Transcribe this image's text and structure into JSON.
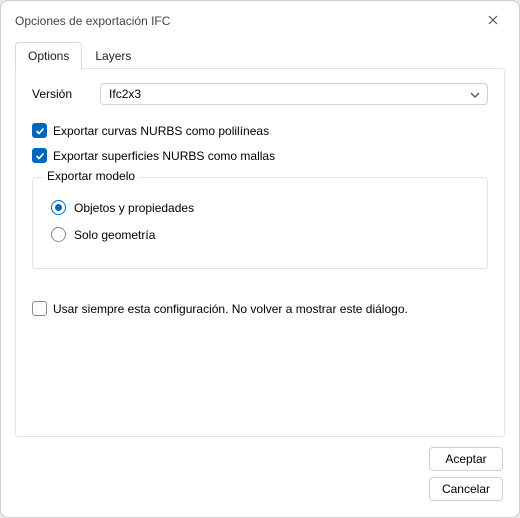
{
  "window": {
    "title": "Opciones de exportación IFC"
  },
  "tabs": {
    "options": "Options",
    "layers": "Layers"
  },
  "version": {
    "label": "Versión",
    "selected": "Ifc2x3"
  },
  "checks": {
    "curves": "Exportar curvas NURBS como polilíneas",
    "surfaces": "Exportar superficies NURBS como mallas"
  },
  "model_group": {
    "legend": "Exportar modelo",
    "objects": "Objetos y propiedades",
    "geometry": "Solo geometría"
  },
  "remember": {
    "label": "Usar siempre esta configuración. No volver a mostrar este diálogo."
  },
  "buttons": {
    "accept": "Aceptar",
    "cancel": "Cancelar"
  }
}
